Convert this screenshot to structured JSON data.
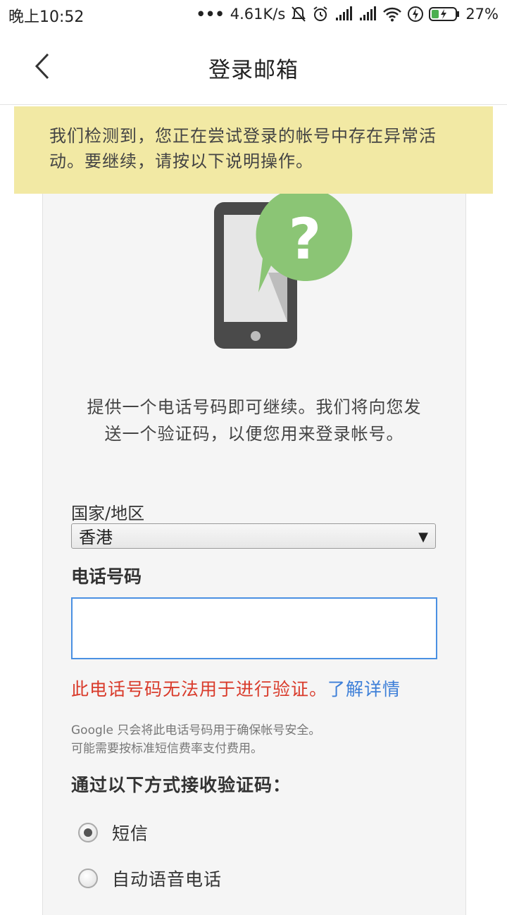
{
  "status_bar": {
    "time": "晚上10:52",
    "dots": "•••",
    "speed": "4.61K/s",
    "battery": "27%",
    "icons": [
      "mute-bell-icon",
      "alarm-icon",
      "signal-icon",
      "signal-icon",
      "wifi-icon",
      "charging-icon",
      "battery-icon"
    ]
  },
  "app_bar": {
    "title": "登录邮箱",
    "back_icon": "chevron-left-icon"
  },
  "warning": {
    "text": "我们检测到，您正在尝试登录的帐号中存在异常活动。要继续，请按以下说明操作。"
  },
  "illustration": {
    "icon": "phone-question-icon",
    "colors": {
      "phone": "#4a4a4a",
      "bubble": "#8bc575",
      "screen": "#e6e6e6"
    }
  },
  "intro": {
    "text": "提供一个电话号码即可继续。我们将向您发送一个验证码，以便您用来登录帐号。"
  },
  "form": {
    "country_label": "国家/地区",
    "country_selected": "香港",
    "dropdown_arrow": "▼",
    "phone_label": "电话号码",
    "phone_value": "",
    "error_text": "此电话号码无法用于进行验证。",
    "learn_more": "了解详情",
    "note_line1": "Google 只会将此电话号码用于确保帐号安全。",
    "note_line2": "可能需要按标准短信费率支付费用。",
    "method_label": "通过以下方式接收验证码：",
    "options": [
      {
        "label": "短信",
        "checked": true
      },
      {
        "label": "自动语音电话",
        "checked": false
      }
    ]
  },
  "colors": {
    "warning_bg": "#f2e9a4",
    "error": "#d93b2b",
    "link": "#3d7fd8",
    "input_border": "#4a90e2"
  }
}
